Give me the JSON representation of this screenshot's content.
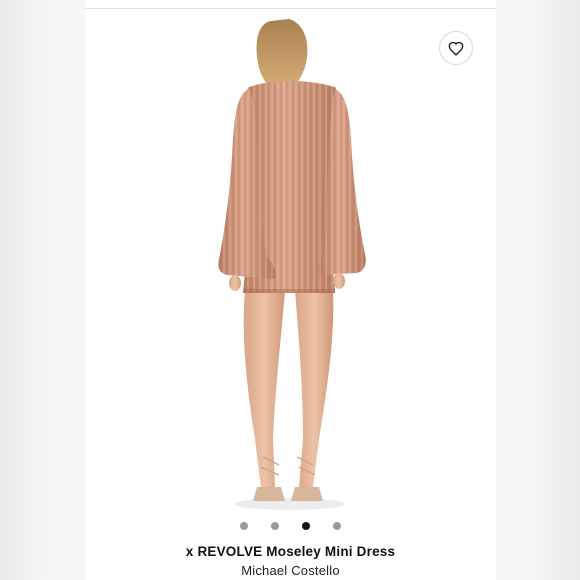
{
  "product": {
    "title": "x REVOLVE Moseley Mini Dress",
    "brand": "Michael Costello"
  },
  "gallery": {
    "image_count": 4,
    "active_index": 3,
    "image_alt": "Back view of model wearing rose-gold metallic ribbed mini dress with bell sleeves"
  },
  "icons": {
    "favorite": "heart-outline-icon"
  },
  "colors": {
    "dress": "#c98e72",
    "dot_inactive": "#9a9a9a",
    "dot_active": "#111111"
  }
}
